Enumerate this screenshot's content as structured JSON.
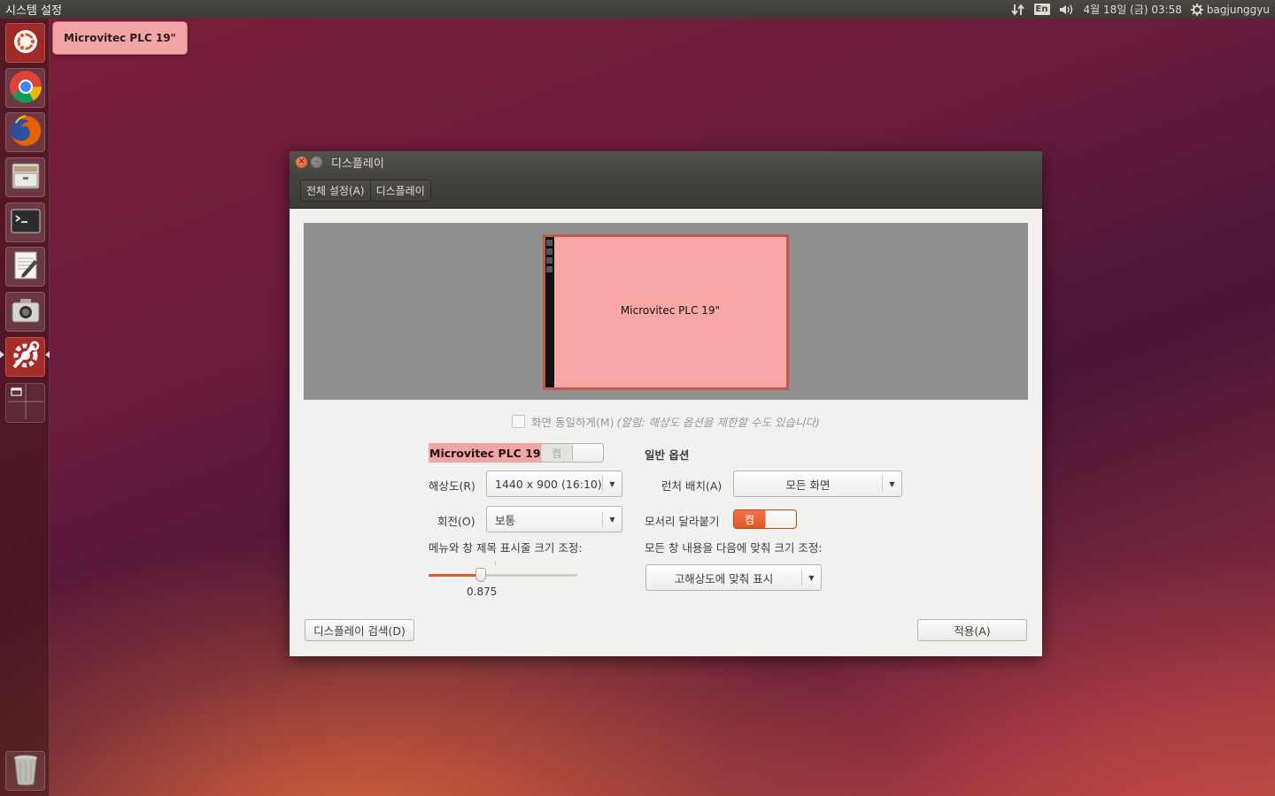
{
  "top_panel": {
    "app_title": "시스템 설정",
    "keyboard_layout": "En",
    "datetime": "4월 18일 (금) 03:58",
    "username": "bagjunggyu"
  },
  "launcher": {
    "items": [
      {
        "icon": "ubuntu-dash-icon"
      },
      {
        "icon": "chrome-icon"
      },
      {
        "icon": "firefox-icon"
      },
      {
        "icon": "files-icon"
      },
      {
        "icon": "terminal-icon"
      },
      {
        "icon": "text-editor-icon"
      },
      {
        "icon": "screenshot-icon"
      },
      {
        "icon": "system-settings-icon"
      },
      {
        "icon": "workspace-switcher-icon"
      },
      {
        "icon": "trash-icon"
      }
    ],
    "tooltip": "Microvitec PLC 19\""
  },
  "window": {
    "title": "디스플레이",
    "breadcrumbs": [
      "전체 설정(A)",
      "디스플레이"
    ],
    "preview_monitor_label": "Microvitec PLC 19\"",
    "mirror": {
      "label": "화면 동일하게(M)",
      "note": "(알림: 해상도 옵션을 제한할 수도 있습니다)",
      "checked": false
    },
    "monitor_name": "Microvitec PLC 19\"",
    "monitor_toggle_label": "켬",
    "resolution": {
      "label": "해상도(R)",
      "value": "1440 x 900 (16:10)"
    },
    "rotation": {
      "label": "회전(O)",
      "value": "보통"
    },
    "scale": {
      "label": "메뉴와 창 제목 표시줄 크기 조정:",
      "value": "0.875",
      "fraction": 0.35
    },
    "general_options": {
      "heading": "일반 옵션",
      "launcher_placement": {
        "label": "런처 배치(A)",
        "value": "모든 화면"
      },
      "sticky_edges": {
        "label": "모서리 달라붙기",
        "toggle_label": "켬"
      },
      "scale_all": {
        "label": "모든 창 내용을 다음에 맞춰 크기 조정:",
        "value": "고해상도에 맞춰 표시"
      }
    },
    "detect_button": "디스플레이 검색(D)",
    "apply_button": "적용(A)"
  },
  "colors": {
    "accent": "#e05a28",
    "highlight": "#f3a5a5",
    "panel": "#3c3b37"
  }
}
